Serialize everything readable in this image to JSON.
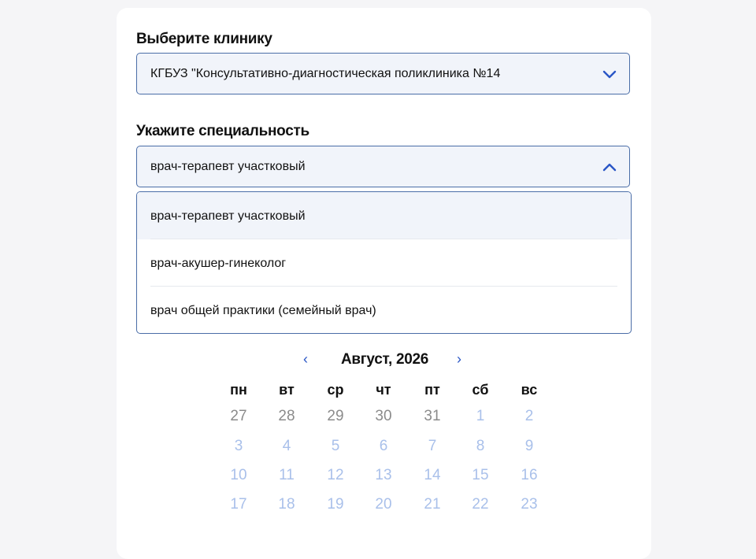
{
  "clinic": {
    "label": "Выберите клинику",
    "value": "КГБУЗ \"Консультативно-диагностическая поликлиника №14"
  },
  "specialty": {
    "label": "Укажите специальность",
    "value": "врач-терапевт участковый",
    "options": [
      {
        "label": "врач-терапевт участковый",
        "selected": true
      },
      {
        "label": "врач-акушер-гинеколог",
        "selected": false
      },
      {
        "label": "врач общей практики (семейный врач)",
        "selected": false
      }
    ]
  },
  "calendar": {
    "prev_icon": "‹",
    "next_icon": "›",
    "month_label": "Август, 2026",
    "weekdays": [
      "пн",
      "вт",
      "ср",
      "чт",
      "пт",
      "сб",
      "вс"
    ],
    "weeks": [
      [
        "27",
        "28",
        "29",
        "30",
        "31",
        "1",
        "2"
      ],
      [
        "3",
        "4",
        "5",
        "6",
        "7",
        "8",
        "9"
      ],
      [
        "10",
        "11",
        "12",
        "13",
        "14",
        "15",
        "16"
      ],
      [
        "17",
        "18",
        "19",
        "20",
        "21",
        "22",
        "23"
      ]
    ]
  },
  "colors": {
    "accent": "#2a56c6",
    "border": "#4a6da7",
    "inactive_day": "#8b8b8b",
    "available_day": "#a9c0ea"
  }
}
